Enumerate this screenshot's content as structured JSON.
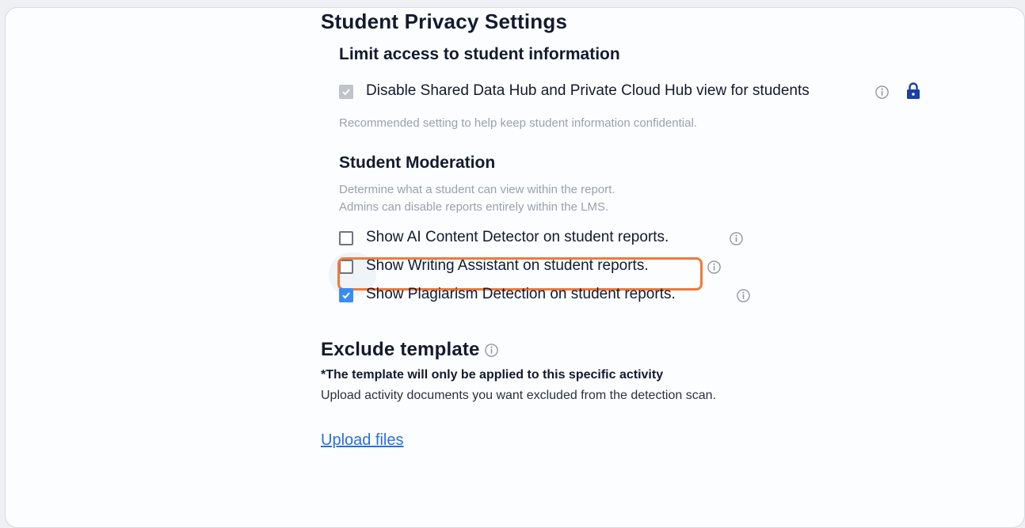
{
  "privacy": {
    "title": "Student Privacy Settings",
    "limit_access": {
      "title": "Limit access to student information",
      "option_label": "Disable Shared Data Hub and Private Cloud Hub view for students",
      "option_checked": true,
      "option_disabled": true,
      "help": "Recommended setting to help keep student information confidential."
    },
    "moderation": {
      "title": "Student Moderation",
      "help_line1": "Determine what a student can view within the report.",
      "help_line2": "Admins can disable reports entirely within the LMS.",
      "options": [
        {
          "label": "Show AI Content Detector on student reports.",
          "checked": false
        },
        {
          "label": "Show Writing Assistant on student reports.",
          "checked": false
        },
        {
          "label": "Show Plagiarism Detection on student reports.",
          "checked": true
        }
      ]
    }
  },
  "exclude": {
    "title": "Exclude template",
    "note": "*The template will only be applied to this specific activity",
    "description": "Upload activity documents you want excluded from the detection scan.",
    "upload_link": "Upload files"
  },
  "colors": {
    "accent": "#3b8cf0",
    "highlight": "#ef7a3c",
    "link": "#2a6fd6",
    "lock": "#1a3fa8"
  },
  "icons": [
    "info-icon",
    "lock-icon",
    "checkmark-icon"
  ]
}
